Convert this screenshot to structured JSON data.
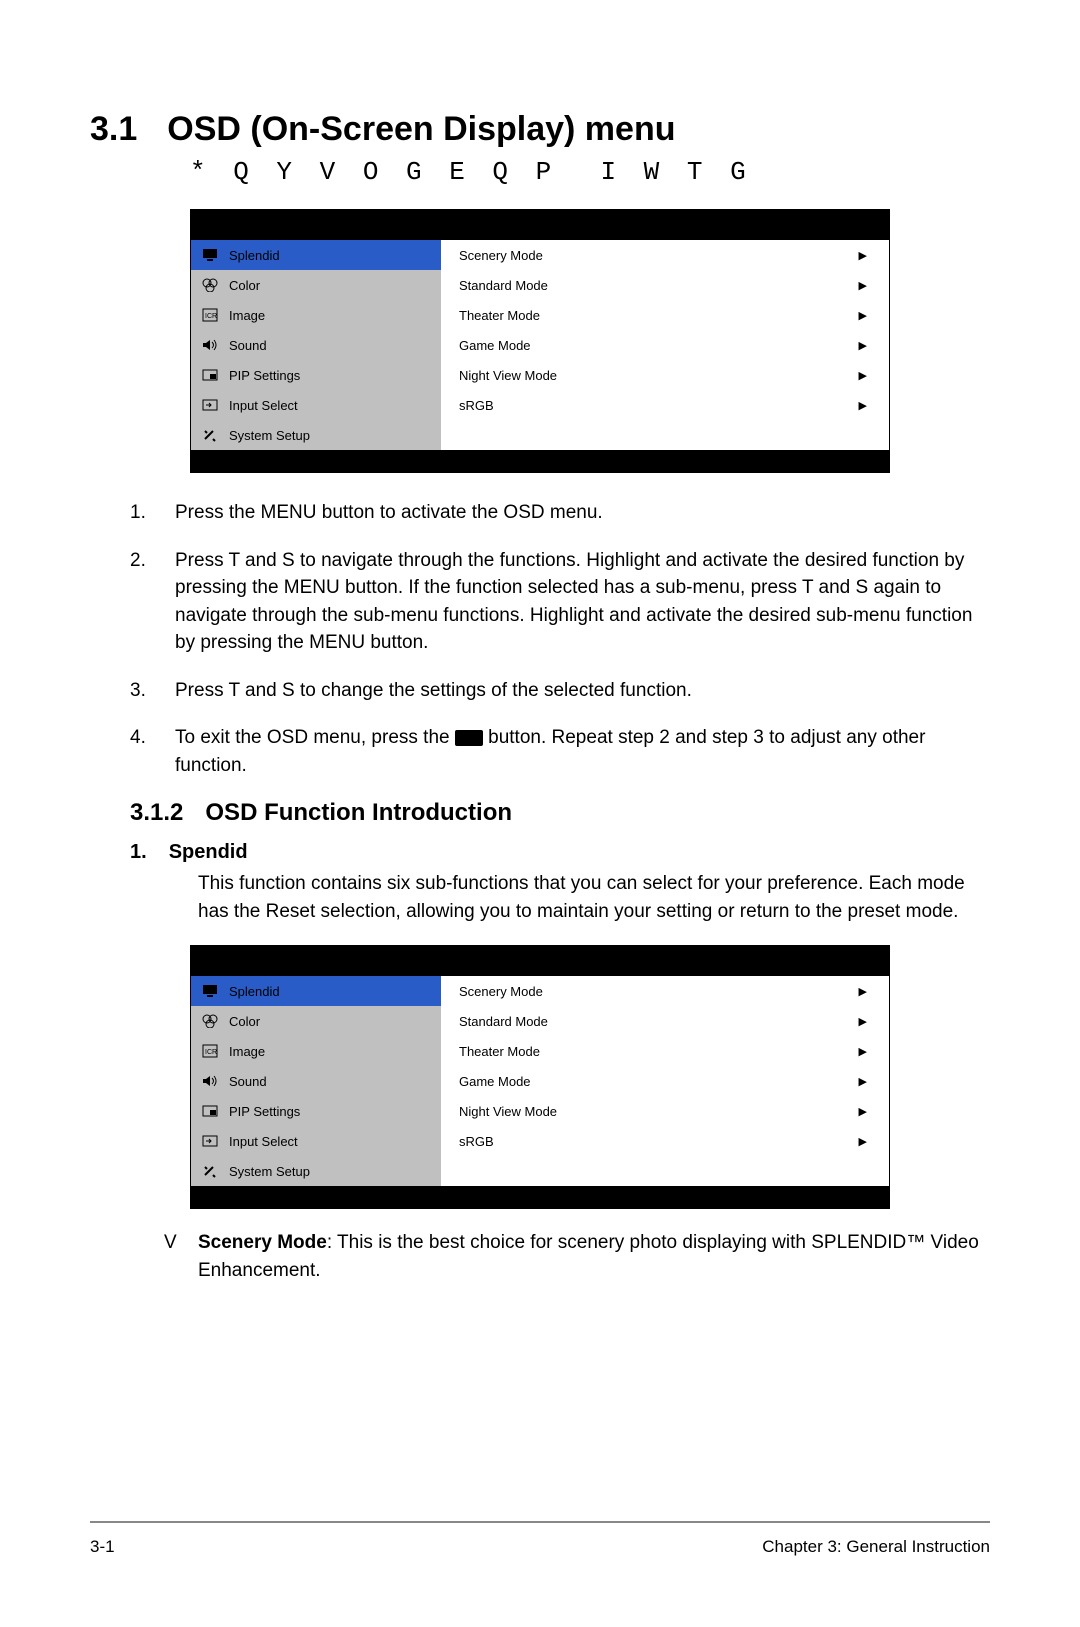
{
  "heading": {
    "num": "3.1",
    "text": "OSD (On-Screen Display) menu"
  },
  "subhead": "* Q Y V O G E Q P  I W T G",
  "osd": {
    "left": [
      {
        "icon": "monitor",
        "label": "Splendid",
        "sel": true
      },
      {
        "icon": "color",
        "label": "Color"
      },
      {
        "icon": "image",
        "label": "Image"
      },
      {
        "icon": "sound",
        "label": "Sound"
      },
      {
        "icon": "pip",
        "label": "PIP Settings"
      },
      {
        "icon": "input",
        "label": "Input Select"
      },
      {
        "icon": "setup",
        "label": "System Setup"
      }
    ],
    "right": [
      "Scenery Mode",
      "Standard Mode",
      "Theater Mode",
      "Game Mode",
      "Night View Mode",
      "sRGB"
    ]
  },
  "steps": {
    "s1": "Press the MENU button to activate the OSD menu.",
    "s2": "Press  T and  S to navigate through the functions. Highlight and activate the desired function by pressing the MENU button. If the function selected has a sub-menu, press  T and  S again to navigate through the sub-menu functions. Highlight and activate the desired sub-menu function by pressing the MENU button.",
    "s3": "Press  T and  S to change the settings of the selected function.",
    "s4a": "To exit the OSD menu, press the ",
    "s4b": " button. Repeat step 2 and step 3 to adjust any other function."
  },
  "sec312": {
    "num": "3.1.2",
    "title": "OSD Function Introduction"
  },
  "splendid": {
    "num": "1.",
    "title": "Spendid",
    "desc": "This function contains six sub-functions that you can select for your preference. Each mode has the Reset selection, allowing you to maintain your setting or return to the preset mode."
  },
  "bullet": {
    "mark": "V",
    "bold": "Scenery Mode",
    "rest": ": This is the best choice for scenery photo displaying with SPLENDID™ Video Enhancement."
  },
  "footer": {
    "left": "3-1",
    "right": "Chapter 3: General Instruction"
  }
}
